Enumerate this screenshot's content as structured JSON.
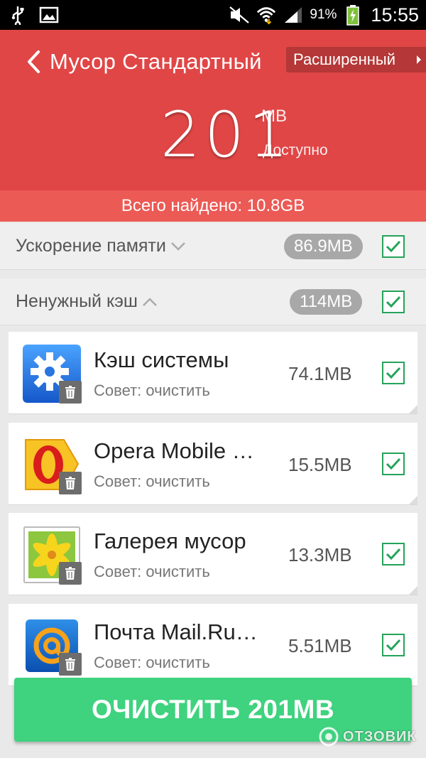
{
  "statusbar": {
    "battery_pct": "91%",
    "time": "15:55",
    "icons": [
      "usb-icon",
      "image-icon",
      "mute-icon",
      "wifi-icon",
      "signal-icon",
      "battery-charging-icon"
    ]
  },
  "header": {
    "title": "Мусор Стандартный",
    "advanced_label": "Расширенный",
    "available_value": "201",
    "available_unit": "MB",
    "available_label": "Доступно",
    "total_found": "Всего найдено: 10.8GB"
  },
  "categories": [
    {
      "label": "Ускорение памяти",
      "size": "86.9MB",
      "expanded": false,
      "checked": true
    },
    {
      "label": "Ненужный кэш",
      "size": "114MB",
      "expanded": true,
      "checked": true
    }
  ],
  "apps": [
    {
      "name": "Кэш системы",
      "tip": "Совет: очистить",
      "size": "74.1MB",
      "icon": "gear-icon",
      "checked": true
    },
    {
      "name": "Opera Mobile …",
      "tip": "Совет: очистить",
      "size": "15.5MB",
      "icon": "opera-icon",
      "checked": true
    },
    {
      "name": "Галерея мусор",
      "tip": "Совет: очистить",
      "size": "13.3MB",
      "icon": "gallery-icon",
      "checked": true
    },
    {
      "name": "Почта Mail.Ru…",
      "tip": "Совет: очистить",
      "size": "5.51MB",
      "icon": "mail-icon",
      "checked": true
    }
  ],
  "clean_button": "ОЧИСТИТЬ 201MB",
  "watermark": "ОТЗОВИК",
  "colors": {
    "header_red": "#e04646",
    "accent_green": "#3fd27f",
    "check_green": "#25a35a"
  }
}
